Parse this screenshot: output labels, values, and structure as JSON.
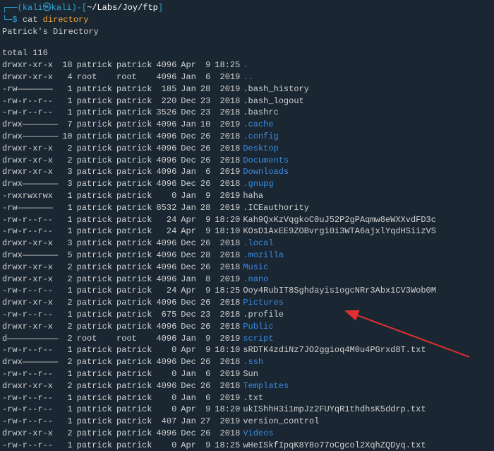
{
  "prompt": {
    "open_paren": "┌──(",
    "user": "kali",
    "at_glyph": "㉿",
    "host": "kali",
    "close_paren": ")",
    "dash_open": "-[",
    "path": "~/Labs/Joy/ftp",
    "dash_close": "]",
    "line2_prefix": "└─",
    "dollar": "$",
    "command": "cat",
    "argument": "directory"
  },
  "header": "Patrick's Directory",
  "total_line": "total 116",
  "rows": [
    {
      "perm": "drwxr-xr-x",
      "links": "18",
      "owner": "patrick",
      "group": "patrick",
      "size": "4096",
      "mon": "Apr",
      "day": "9",
      "time": "18:25",
      "name": ".",
      "is_dir": true
    },
    {
      "perm": "drwxr-xr-x",
      "links": "4",
      "owner": "root",
      "group": "root",
      "size": "4096",
      "mon": "Jan",
      "day": "6",
      "time": "2019",
      "name": "..",
      "is_dir": true
    },
    {
      "perm": "-rw———————",
      "links": "1",
      "owner": "patrick",
      "group": "patrick",
      "size": "185",
      "mon": "Jan",
      "day": "28",
      "time": "2019",
      "name": ".bash_history",
      "is_dir": false
    },
    {
      "perm": "-rw-r--r--",
      "links": "1",
      "owner": "patrick",
      "group": "patrick",
      "size": "220",
      "mon": "Dec",
      "day": "23",
      "time": "2018",
      "name": ".bash_logout",
      "is_dir": false
    },
    {
      "perm": "-rw-r--r--",
      "links": "1",
      "owner": "patrick",
      "group": "patrick",
      "size": "3526",
      "mon": "Dec",
      "day": "23",
      "time": "2018",
      "name": ".bashrc",
      "is_dir": false
    },
    {
      "perm": "drwx———————",
      "links": "7",
      "owner": "patrick",
      "group": "patrick",
      "size": "4096",
      "mon": "Jan",
      "day": "10",
      "time": "2019",
      "name": ".cache",
      "is_dir": true
    },
    {
      "perm": "drwx———————",
      "links": "10",
      "owner": "patrick",
      "group": "patrick",
      "size": "4096",
      "mon": "Dec",
      "day": "26",
      "time": "2018",
      "name": ".config",
      "is_dir": true
    },
    {
      "perm": "drwxr-xr-x",
      "links": "2",
      "owner": "patrick",
      "group": "patrick",
      "size": "4096",
      "mon": "Dec",
      "day": "26",
      "time": "2018",
      "name": "Desktop",
      "is_dir": true
    },
    {
      "perm": "drwxr-xr-x",
      "links": "2",
      "owner": "patrick",
      "group": "patrick",
      "size": "4096",
      "mon": "Dec",
      "day": "26",
      "time": "2018",
      "name": "Documents",
      "is_dir": true
    },
    {
      "perm": "drwxr-xr-x",
      "links": "3",
      "owner": "patrick",
      "group": "patrick",
      "size": "4096",
      "mon": "Jan",
      "day": "6",
      "time": "2019",
      "name": "Downloads",
      "is_dir": true
    },
    {
      "perm": "drwx———————",
      "links": "3",
      "owner": "patrick",
      "group": "patrick",
      "size": "4096",
      "mon": "Dec",
      "day": "26",
      "time": "2018",
      "name": ".gnupg",
      "is_dir": true
    },
    {
      "perm": "-rwxrwxrwx",
      "links": "1",
      "owner": "patrick",
      "group": "patrick",
      "size": "0",
      "mon": "Jan",
      "day": "9",
      "time": "2019",
      "name": "haha",
      "is_dir": false
    },
    {
      "perm": "-rw———————",
      "links": "1",
      "owner": "patrick",
      "group": "patrick",
      "size": "8532",
      "mon": "Jan",
      "day": "28",
      "time": "2019",
      "name": ".ICEauthority",
      "is_dir": false
    },
    {
      "perm": "-rw-r--r--",
      "links": "1",
      "owner": "patrick",
      "group": "patrick",
      "size": "24",
      "mon": "Apr",
      "day": "9",
      "time": "18:20",
      "name": "Kah9QxKzVqgkoC0uJ52P2gPAqmw8eWXXvdFD3c",
      "is_dir": false
    },
    {
      "perm": "-rw-r--r--",
      "links": "1",
      "owner": "patrick",
      "group": "patrick",
      "size": "24",
      "mon": "Apr",
      "day": "9",
      "time": "18:10",
      "name": "KOsD1AxEE9ZOBvrgi0i3WTA6ajxlYqdHSiizVS",
      "is_dir": false
    },
    {
      "perm": "drwxr-xr-x",
      "links": "3",
      "owner": "patrick",
      "group": "patrick",
      "size": "4096",
      "mon": "Dec",
      "day": "26",
      "time": "2018",
      "name": ".local",
      "is_dir": true
    },
    {
      "perm": "drwx———————",
      "links": "5",
      "owner": "patrick",
      "group": "patrick",
      "size": "4096",
      "mon": "Dec",
      "day": "28",
      "time": "2018",
      "name": ".mozilla",
      "is_dir": true
    },
    {
      "perm": "drwxr-xr-x",
      "links": "2",
      "owner": "patrick",
      "group": "patrick",
      "size": "4096",
      "mon": "Dec",
      "day": "26",
      "time": "2018",
      "name": "Music",
      "is_dir": true
    },
    {
      "perm": "drwxr-xr-x",
      "links": "2",
      "owner": "patrick",
      "group": "patrick",
      "size": "4096",
      "mon": "Jan",
      "day": "8",
      "time": "2019",
      "name": ".nano",
      "is_dir": true
    },
    {
      "perm": "-rw-r--r--",
      "links": "1",
      "owner": "patrick",
      "group": "patrick",
      "size": "24",
      "mon": "Apr",
      "day": "9",
      "time": "18:25",
      "name": "Ooy4RubIT8Sghdayis1ogcNRr3Abx1CV3Wob0M",
      "is_dir": false
    },
    {
      "perm": "drwxr-xr-x",
      "links": "2",
      "owner": "patrick",
      "group": "patrick",
      "size": "4096",
      "mon": "Dec",
      "day": "26",
      "time": "2018",
      "name": "Pictures",
      "is_dir": true
    },
    {
      "perm": "-rw-r--r--",
      "links": "1",
      "owner": "patrick",
      "group": "patrick",
      "size": "675",
      "mon": "Dec",
      "day": "23",
      "time": "2018",
      "name": ".profile",
      "is_dir": false
    },
    {
      "perm": "drwxr-xr-x",
      "links": "2",
      "owner": "patrick",
      "group": "patrick",
      "size": "4096",
      "mon": "Dec",
      "day": "26",
      "time": "2018",
      "name": "Public",
      "is_dir": true
    },
    {
      "perm": "d——————————",
      "links": "2",
      "owner": "root",
      "group": "root",
      "size": "4096",
      "mon": "Jan",
      "day": "9",
      "time": "2019",
      "name": "script",
      "is_dir": true
    },
    {
      "perm": "-rw-r--r--",
      "links": "1",
      "owner": "patrick",
      "group": "patrick",
      "size": "0",
      "mon": "Apr",
      "day": "9",
      "time": "18:10",
      "name": "sRDTK4zdiNz7JO2ggioq4M0u4PGrxd8T.txt",
      "is_dir": false
    },
    {
      "perm": "drwx———————",
      "links": "2",
      "owner": "patrick",
      "group": "patrick",
      "size": "4096",
      "mon": "Dec",
      "day": "26",
      "time": "2018",
      "name": ".ssh",
      "is_dir": true
    },
    {
      "perm": "-rw-r--r--",
      "links": "1",
      "owner": "patrick",
      "group": "patrick",
      "size": "0",
      "mon": "Jan",
      "day": "6",
      "time": "2019",
      "name": "Sun",
      "is_dir": false
    },
    {
      "perm": "drwxr-xr-x",
      "links": "2",
      "owner": "patrick",
      "group": "patrick",
      "size": "4096",
      "mon": "Dec",
      "day": "26",
      "time": "2018",
      "name": "Templates",
      "is_dir": true
    },
    {
      "perm": "-rw-r--r--",
      "links": "1",
      "owner": "patrick",
      "group": "patrick",
      "size": "0",
      "mon": "Jan",
      "day": "6",
      "time": "2019",
      "name": ".txt",
      "is_dir": false
    },
    {
      "perm": "-rw-r--r--",
      "links": "1",
      "owner": "patrick",
      "group": "patrick",
      "size": "0",
      "mon": "Apr",
      "day": "9",
      "time": "18:20",
      "name": "ukIShhH3i1mpJz2FUYqR1thdhsK5ddrp.txt",
      "is_dir": false
    },
    {
      "perm": "-rw-r--r--",
      "links": "1",
      "owner": "patrick",
      "group": "patrick",
      "size": "407",
      "mon": "Jan",
      "day": "27",
      "time": "2019",
      "name": "version_control",
      "is_dir": false
    },
    {
      "perm": "drwxr-xr-x",
      "links": "2",
      "owner": "patrick",
      "group": "patrick",
      "size": "4096",
      "mon": "Dec",
      "day": "26",
      "time": "2018",
      "name": "Videos",
      "is_dir": true
    },
    {
      "perm": "-rw-r--r--",
      "links": "1",
      "owner": "patrick",
      "group": "patrick",
      "size": "0",
      "mon": "Apr",
      "day": "9",
      "time": "18:25",
      "name": "wHeISkfIpqK8Y8o77oCgcol2XqhZQDyq.txt",
      "is_dir": false
    }
  ]
}
